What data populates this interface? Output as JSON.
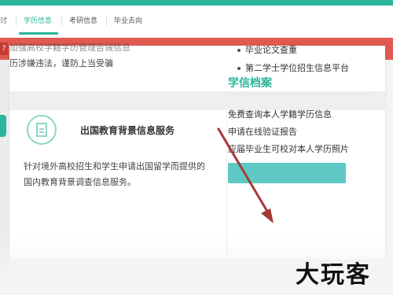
{
  "topnav": {
    "tabs": [
      {
        "label": "讨"
      },
      {
        "label": "学历信息"
      },
      {
        "label": "考研信息"
      },
      {
        "label": "毕业去向"
      }
    ],
    "accent_color": "#2bb59a"
  },
  "redband": {
    "badge": "?",
    "color": "#e05a52"
  },
  "notice": {
    "cut_line": "加强高校学籍学历管理告诫信息",
    "line": "历涉嫌违法，谨防上当受骗"
  },
  "right_links": [
    {
      "label": "毕业论文查重"
    },
    {
      "label": "第二学士学位招生信息平台"
    }
  ],
  "service": {
    "title": "出国教育背景信息服务",
    "description": "针对境外高校招生和学生申请出国留学而提供的国内教育背景调查信息服务。"
  },
  "xueli": {
    "heading": "学信档案",
    "links": [
      {
        "label": "免费查询本人学籍学历信息"
      },
      {
        "label": "申请在线验证报告"
      },
      {
        "label": "应届毕业生可校对本人学历照片"
      }
    ],
    "button_label": ""
  },
  "watermark": "大玩客"
}
